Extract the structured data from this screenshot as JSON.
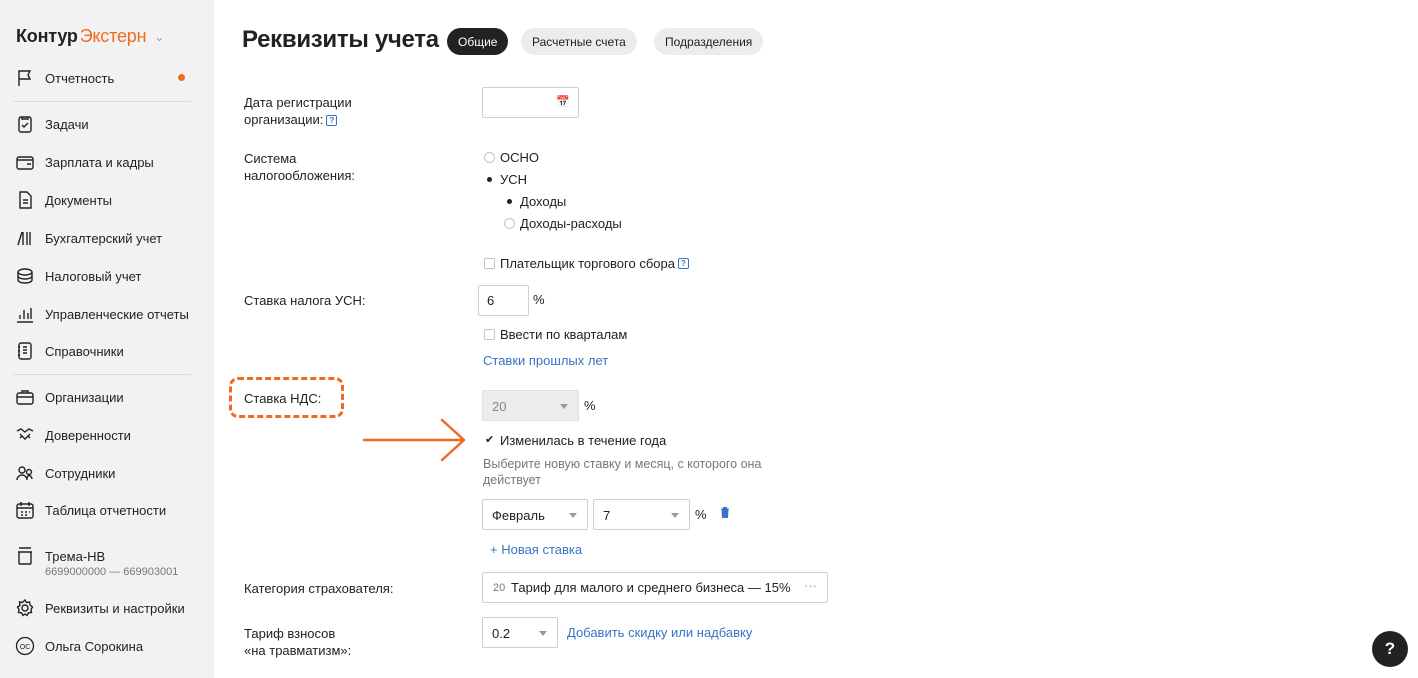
{
  "brand": {
    "name": "Контур",
    "product": "Экстерн"
  },
  "sidebar": {
    "items": [
      {
        "label": "Отчетность",
        "icon": "flag-icon"
      },
      {
        "label": "Задачи",
        "icon": "checklist-icon"
      },
      {
        "label": "Зарплата и кадры",
        "icon": "wallet-icon"
      },
      {
        "label": "Документы",
        "icon": "document-icon"
      },
      {
        "label": "Бухгалтерский учет",
        "icon": "books-icon"
      },
      {
        "label": "Налоговый учет",
        "icon": "coins-icon"
      },
      {
        "label": "Управленческие отчеты",
        "icon": "bar-chart-icon"
      },
      {
        "label": "Справочники",
        "icon": "directory-icon"
      },
      {
        "label": "Организации",
        "icon": "briefcase-icon"
      },
      {
        "label": "Доверенности",
        "icon": "handshake-icon"
      },
      {
        "label": "Сотрудники",
        "icon": "people-icon"
      },
      {
        "label": "Таблица отчетности",
        "icon": "calendar-icon"
      },
      {
        "label": "Трема-НВ",
        "icon": "building-icon",
        "sub": "6699000000 — 669903001"
      },
      {
        "label": "Реквизиты и настройки",
        "icon": "gear-icon"
      },
      {
        "label": "Ольга Сорокина",
        "icon": "avatar-icon",
        "avatar_initials": "ОС"
      }
    ]
  },
  "header": {
    "title": "Реквизиты учета",
    "tabs": [
      {
        "label": "Общие",
        "active": true
      },
      {
        "label": "Расчетные счета",
        "active": false
      },
      {
        "label": "Подразделения",
        "active": false
      }
    ]
  },
  "form": {
    "reg_date": {
      "label_line1": "Дата регистрации",
      "label_line2": "организации:",
      "help": "?",
      "value": ""
    },
    "tax_system": {
      "label_line1": "Система",
      "label_line2": "налогообложения:",
      "options": [
        {
          "label": "ОСНО",
          "selected": false
        },
        {
          "label": "УСН",
          "selected": true
        }
      ],
      "sub_options": [
        {
          "label": "Доходы",
          "selected": true
        },
        {
          "label": "Доходы-расходы",
          "selected": false
        }
      ]
    },
    "trade_fee": {
      "label": "Плательщик торгового сбора",
      "checked": false,
      "help": "?"
    },
    "usn_rate": {
      "label": "Ставка налога УСН:",
      "value": "6",
      "unit": "%"
    },
    "quarterly": {
      "label": "Ввести по кварталам",
      "checked": false
    },
    "past_rates_link": "Ставки прошлых лет",
    "vat": {
      "label": "Ставка НДС:",
      "value": "20",
      "unit": "%"
    },
    "vat_changed": {
      "label": "Изменилась в течение года",
      "checked": true
    },
    "vat_hint": "Выберите новую ставку и месяц, с которого она действует",
    "new_rate_row": {
      "month": "Февраль",
      "rate": "7",
      "unit": "%"
    },
    "add_rate_link": "+ Новая ставка",
    "insurer": {
      "label": "Категория страхователя:",
      "code": "20",
      "value": "Тариф для малого и среднего бизнеса — 15%",
      "more": "···"
    },
    "injury": {
      "label_line1": "Тариф взносов",
      "label_line2": "«на травматизм»:",
      "value": "0.2",
      "link": "Добавить скидку или надбавку"
    }
  },
  "fab": {
    "label": "?"
  },
  "colors": {
    "accent": "#f06b1f",
    "link": "#3a73c4",
    "dark": "#222222"
  }
}
